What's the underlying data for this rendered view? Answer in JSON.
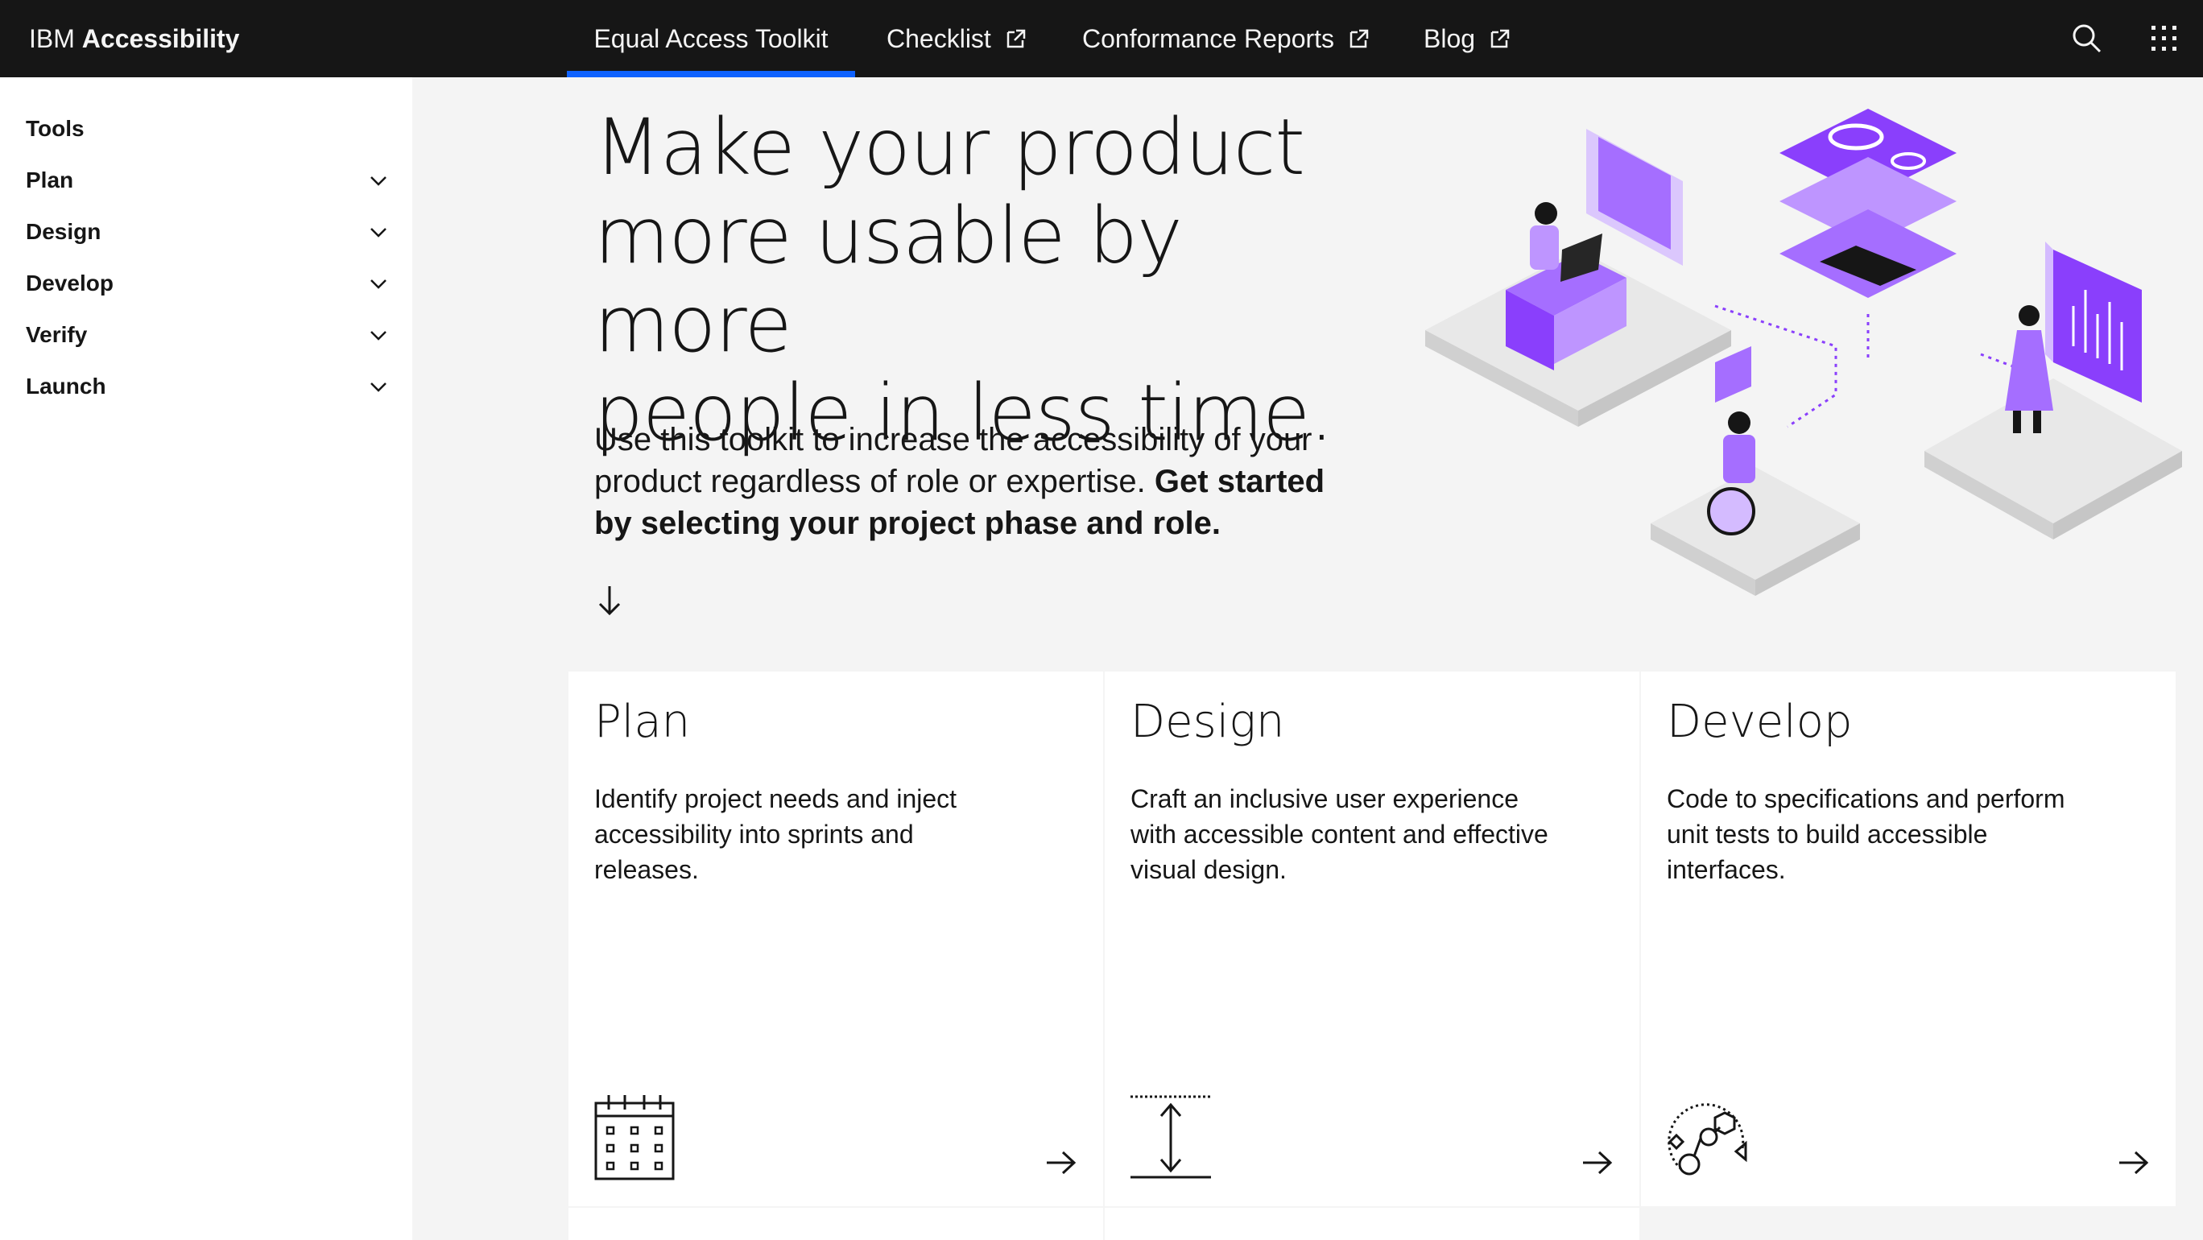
{
  "header": {
    "brand_prefix": "IBM",
    "brand_name": "Accessibility",
    "nav": [
      {
        "label": "Equal Access Toolkit",
        "external": false,
        "active": true
      },
      {
        "label": "Checklist",
        "external": true
      },
      {
        "label": "Conformance Reports",
        "external": true
      },
      {
        "label": "Blog",
        "external": true
      }
    ],
    "icons": [
      "search-icon",
      "app-switcher-icon"
    ]
  },
  "sidebar": {
    "items": [
      {
        "label": "Tools",
        "expandable": false
      },
      {
        "label": "Plan",
        "expandable": true
      },
      {
        "label": "Design",
        "expandable": true
      },
      {
        "label": "Develop",
        "expandable": true
      },
      {
        "label": "Verify",
        "expandable": true
      },
      {
        "label": "Launch",
        "expandable": true
      }
    ]
  },
  "hero": {
    "title_line1": "Make your product",
    "title_line2": "more usable by more",
    "title_line3": "people in less time.",
    "text_regular": "Use this toolkit to increase the accessibility of your product regardless of role or expertise.",
    "text_bold": "Get started by selecting your project phase and role."
  },
  "cards": [
    {
      "title": "Plan",
      "description": "Identify project needs and inject accessibility into sprints and releases.",
      "icon": "calendar-icon"
    },
    {
      "title": "Design",
      "description": "Craft an inclusive user experience with accessible content and effective visual design.",
      "icon": "height-measure-icon"
    },
    {
      "title": "Develop",
      "description": "Code to specifications and perform unit tests to build accessible interfaces.",
      "icon": "code-cycle-icon"
    }
  ],
  "colors": {
    "header_bg": "#161616",
    "active_tab": "#0f62fe",
    "page_bg": "#f4f4f4",
    "illustration_purple": "#8a3ffc"
  }
}
